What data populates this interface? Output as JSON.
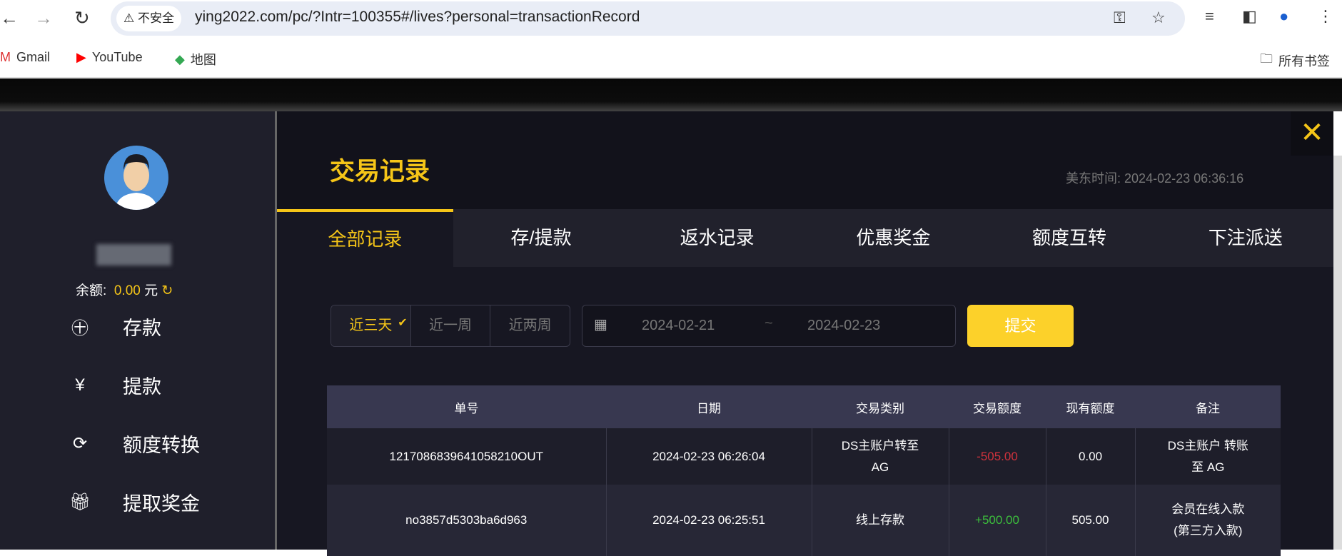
{
  "browser": {
    "security": "不安全",
    "url": "ying2022.com/pc/?Intr=100355#/lives?personal=transactionRecord",
    "bookmarks": [
      "Gmail",
      "YouTube",
      "地图"
    ],
    "all_bookmarks": "所有书签"
  },
  "sidebar": {
    "balance_label": "余额:",
    "balance_value": "0.00",
    "currency": "元",
    "menu": [
      {
        "icon": "deposit-icon",
        "label": "存款"
      },
      {
        "icon": "withdraw-icon",
        "label": "提款"
      },
      {
        "icon": "transfer-icon",
        "label": "额度转换"
      },
      {
        "icon": "gift-icon",
        "label": "提取奖金"
      }
    ]
  },
  "main": {
    "title": "交易记录",
    "us_time_label": "美东时间:",
    "us_time": "2024-02-23 06:36:16",
    "tabs": [
      "全部记录",
      "存/提款",
      "返水记录",
      "优惠奖金",
      "额度互转",
      "下注派送"
    ],
    "ranges": [
      "近三天",
      "近一周",
      "近两周"
    ],
    "start_date": "2024-02-21",
    "date_sep": "~",
    "end_date": "2024-02-23",
    "submit": "提交"
  },
  "table": {
    "headers": [
      "单号",
      "日期",
      "交易类别",
      "交易额度",
      "现有额度",
      "备注"
    ],
    "rows": [
      [
        "1217086839641058210OUT",
        "2024-02-23 06:26:04",
        "DS主账户转至AG",
        "-505.00",
        "0.00",
        "DS主账户 转账至 AG"
      ],
      [
        "no3857d5303ba6d963",
        "2024-02-23 06:25:51",
        "线上存款",
        "+500.00",
        "505.00",
        "会员在线入款(第三方入款)"
      ]
    ]
  },
  "colors": {
    "accent": "#f5c518",
    "negative": "#d0323c",
    "positive": "#3cbf3c"
  }
}
